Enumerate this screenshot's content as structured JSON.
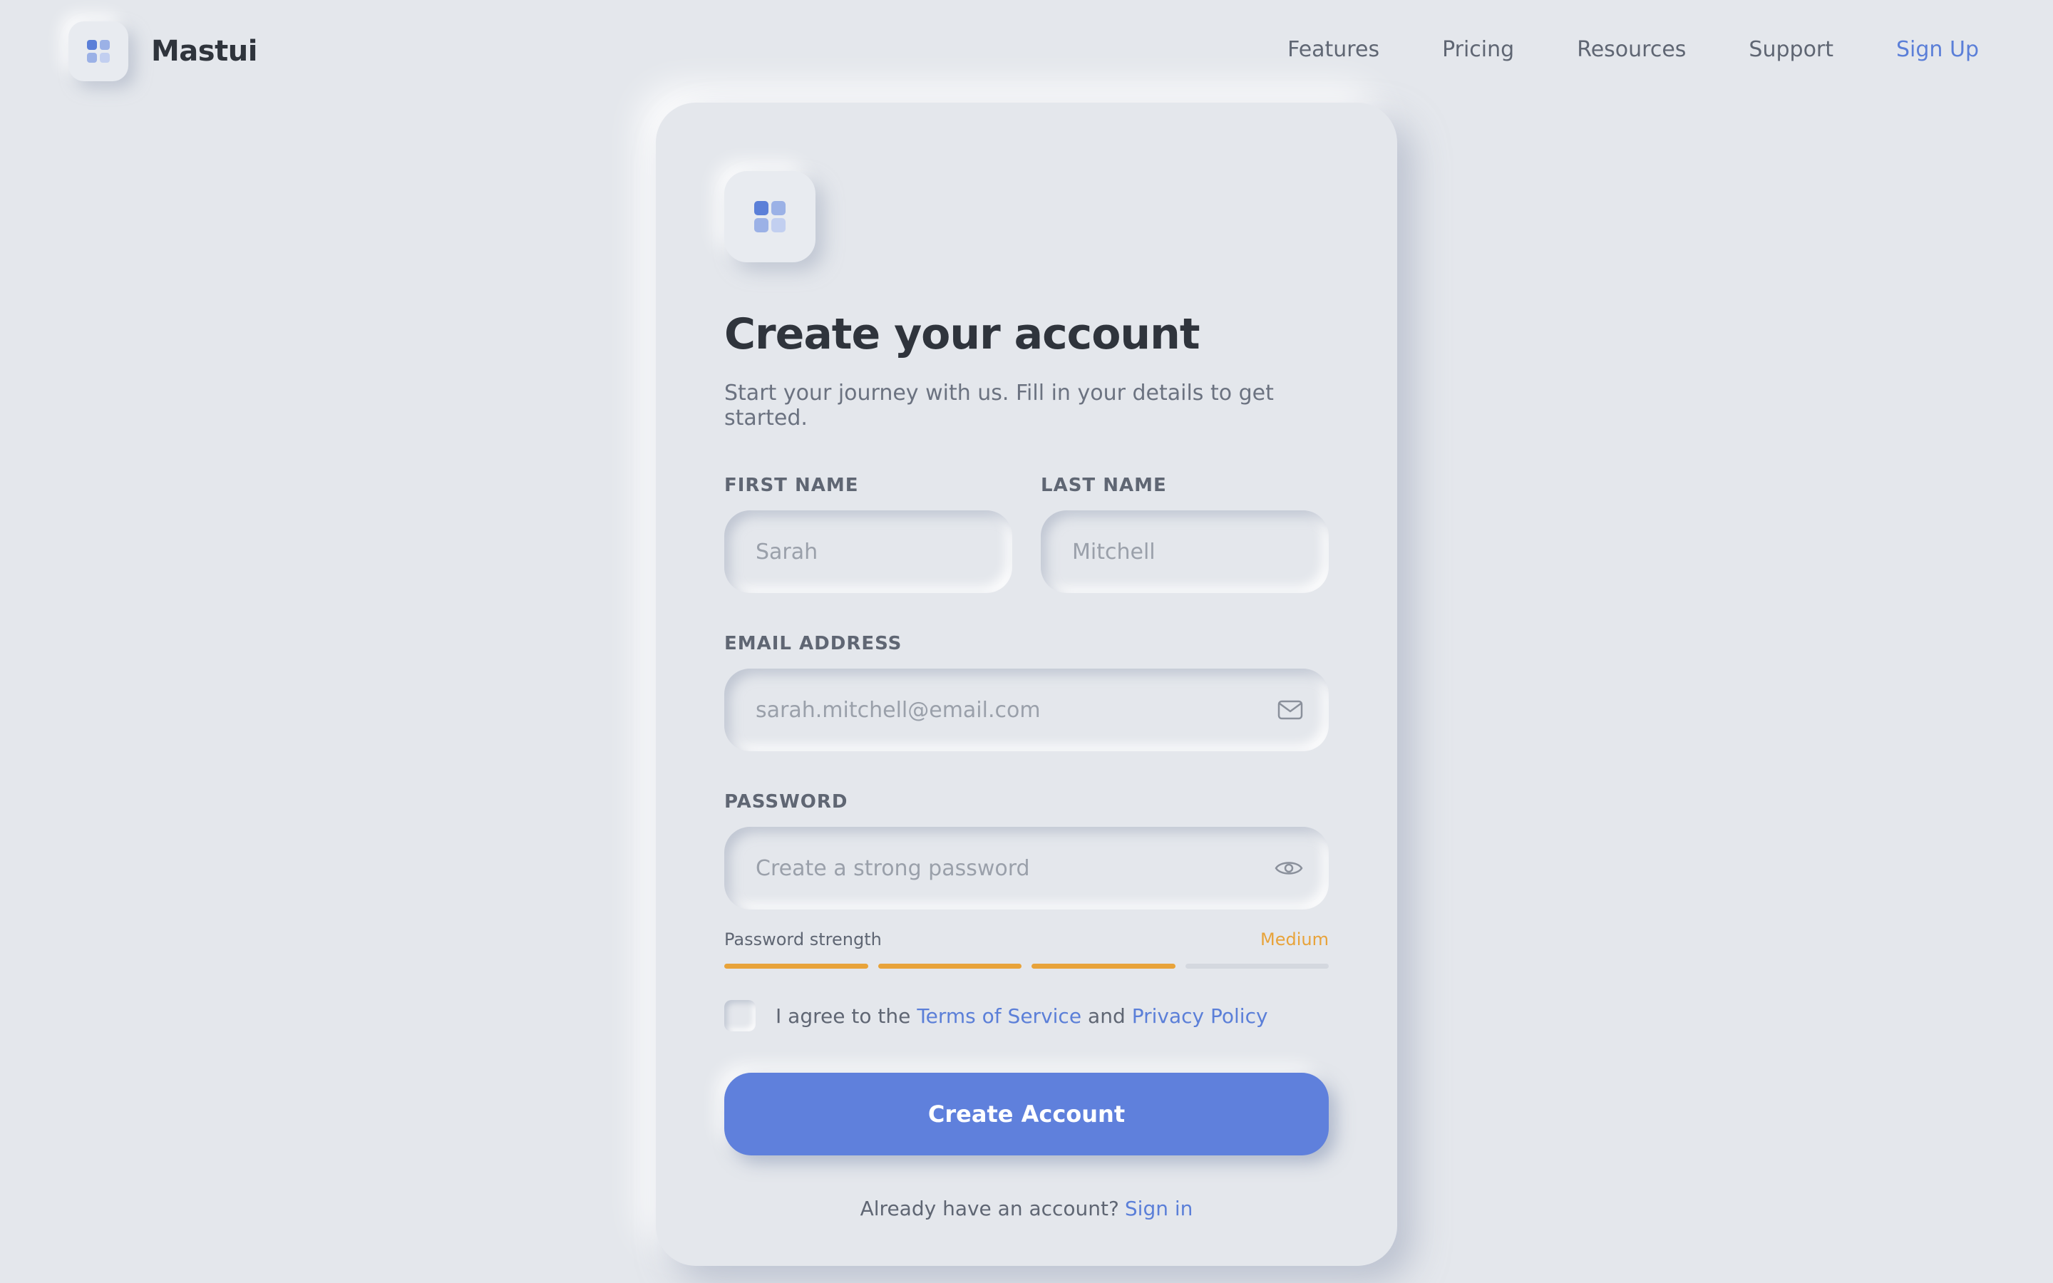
{
  "brand": {
    "name": "Mastui",
    "icon": "grid-logo-icon"
  },
  "nav": {
    "items": [
      "Features",
      "Pricing",
      "Resources",
      "Support"
    ],
    "signup": "Sign Up"
  },
  "form": {
    "logo_icon": "grid-logo-icon",
    "title": "Create your account",
    "subtitle": "Start your journey with us. Fill in your details to get started.",
    "first_name": {
      "label": "FIRST NAME",
      "placeholder": "Sarah",
      "value": ""
    },
    "last_name": {
      "label": "LAST NAME",
      "placeholder": "Mitchell",
      "value": ""
    },
    "email": {
      "label": "EMAIL ADDRESS",
      "placeholder": "sarah.mitchell@email.com",
      "value": "",
      "icon": "mail-icon"
    },
    "password": {
      "label": "PASSWORD",
      "placeholder": "Create a strong password",
      "value": "",
      "icon": "eye-icon"
    },
    "strength": {
      "label": "Password strength",
      "value": "Medium",
      "level": 0.75,
      "segments_total": 4,
      "segments_filled": 3,
      "color": "#e8a33a"
    },
    "agree": {
      "prefix": "I agree to the",
      "terms": "Terms of Service",
      "and": "and",
      "privacy": "Privacy Policy",
      "checked": false
    },
    "submit": "Create Account",
    "signin_prompt": "Already have an account?",
    "signin_link": "Sign in"
  },
  "colors": {
    "accent": "#5b7fd8",
    "background": "#e4e7ec",
    "warning": "#e8a33a",
    "text": "#2f343c"
  }
}
